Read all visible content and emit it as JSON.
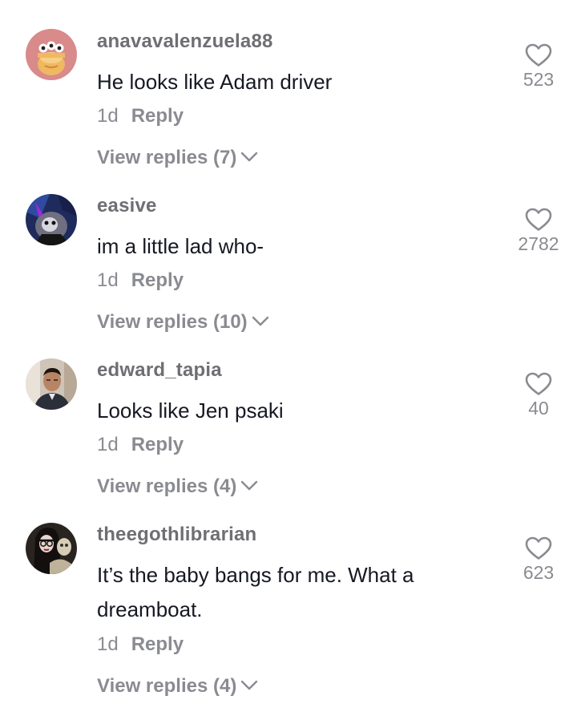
{
  "comments": [
    {
      "username": "anavavalenzuela88",
      "text": "He looks like Adam driver",
      "date": "1d",
      "reply_label": "Reply",
      "view_replies": "View replies (7)",
      "likes": "523",
      "avatar_bg": "#d98a8a",
      "avatar_icon": "cartoon-bun-avatar"
    },
    {
      "username": "easive",
      "text": "im a little lad who-",
      "date": "1d",
      "reply_label": "Reply",
      "view_replies": "View replies (10)",
      "likes": "2782",
      "avatar_bg": "#1f2b5c",
      "avatar_icon": "dark-character-avatar"
    },
    {
      "username": "edward_tapia",
      "text": "Looks like Jen psaki",
      "date": "1d",
      "reply_label": "Reply",
      "view_replies": "View replies (4)",
      "likes": "40",
      "avatar_bg": "#cfc4b8",
      "avatar_icon": "man-photo-avatar"
    },
    {
      "username": "theegothlibrarian",
      "text": "It’s the baby bangs for me. What a dreamboat.",
      "date": "1d",
      "reply_label": "Reply",
      "view_replies": "View replies (4)",
      "likes": "623",
      "avatar_bg": "#2a2420",
      "avatar_icon": "woman-photo-avatar"
    }
  ],
  "icons": {
    "like": "heart-outline-icon",
    "expand": "chevron-down-icon"
  },
  "colors": {
    "username": "#6e6e73",
    "text": "#161823",
    "secondary": "#8a8b91"
  }
}
